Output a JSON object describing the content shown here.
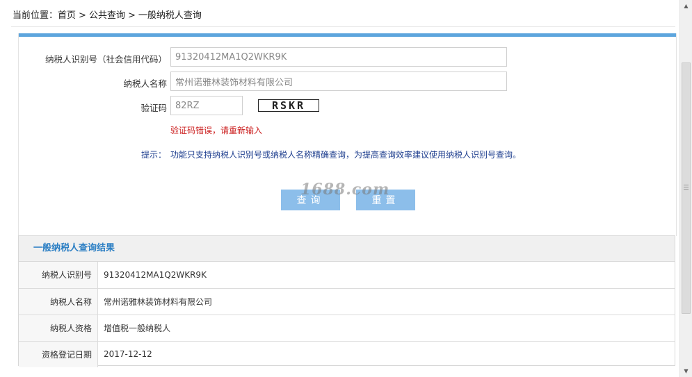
{
  "breadcrumb": {
    "prefix": "当前位置：",
    "items": [
      "首页",
      "公共查询",
      "一般纳税人查询"
    ],
    "separator": ">"
  },
  "form": {
    "taxpayer_id": {
      "label": "纳税人识别号（社会信用代码）",
      "value": "91320412MA1Q2WKR9K"
    },
    "taxpayer_name": {
      "label": "纳税人名称",
      "value": "常州诺雅林装饰材料有限公司"
    },
    "captcha": {
      "label": "验证码",
      "value": "82RZ",
      "image_text": "RSKR"
    },
    "error_message": "验证码错误，请重新输入",
    "hint_label": "提示：",
    "hint_text": "功能只支持纳税人识别号或纳税人名称精确查询，为提高查询效率建议使用纳税人识别号查询。",
    "query_button": "查询",
    "reset_button": "重置"
  },
  "watermark": "1688.com",
  "results": {
    "title": "一般纳税人查询结果",
    "rows": [
      {
        "key": "纳税人识别号",
        "value": "91320412MA1Q2WKR9K"
      },
      {
        "key": "纳税人名称",
        "value": "常州诺雅林装饰材料有限公司"
      },
      {
        "key": "纳税人资格",
        "value": "增值税一般纳税人"
      },
      {
        "key": "资格登记日期",
        "value": "2017-12-12"
      }
    ]
  },
  "colors": {
    "accent_bar": "#5da5dd",
    "button": "#8cbeea",
    "error": "#cc2222",
    "hint": "#1f3f8f",
    "result_title": "#2c7fc4"
  }
}
